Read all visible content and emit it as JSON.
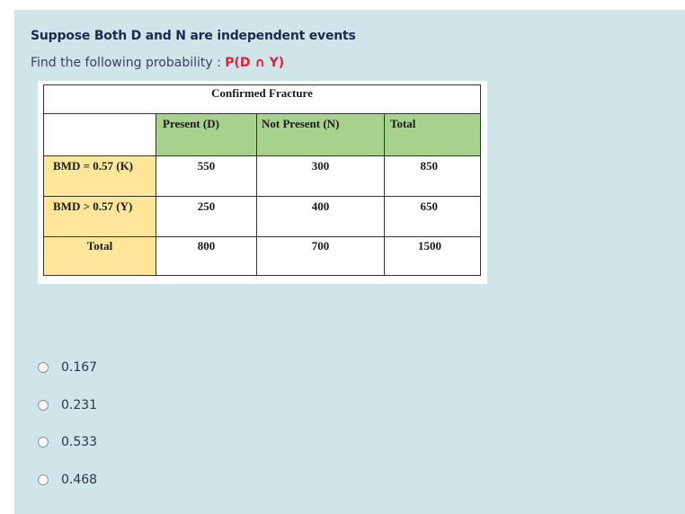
{
  "question": {
    "line1": "Suppose Both D and N are independent events",
    "line2_prefix": "Find the following probability  : ",
    "line2_highlight": "P(D ∩ Y)"
  },
  "table": {
    "title": "Confirmed Fracture",
    "col_headers": [
      "Present (D)",
      "Not Present (N)",
      "Total"
    ],
    "rows": [
      {
        "label": "BMD = 0.57 (K)",
        "values": [
          "550",
          "300",
          "850"
        ]
      },
      {
        "label": "BMD > 0.57 (Y)",
        "values": [
          "250",
          "400",
          "650"
        ]
      },
      {
        "label": "Total",
        "values": [
          "800",
          "700",
          "1500"
        ]
      }
    ],
    "colors": {
      "header_green": "#a9d18e",
      "rowlabel_yellow": "#ffe699"
    }
  },
  "options": [
    {
      "label": "0.167"
    },
    {
      "label": "0.231"
    },
    {
      "label": "0.533"
    },
    {
      "label": "0.468"
    }
  ]
}
